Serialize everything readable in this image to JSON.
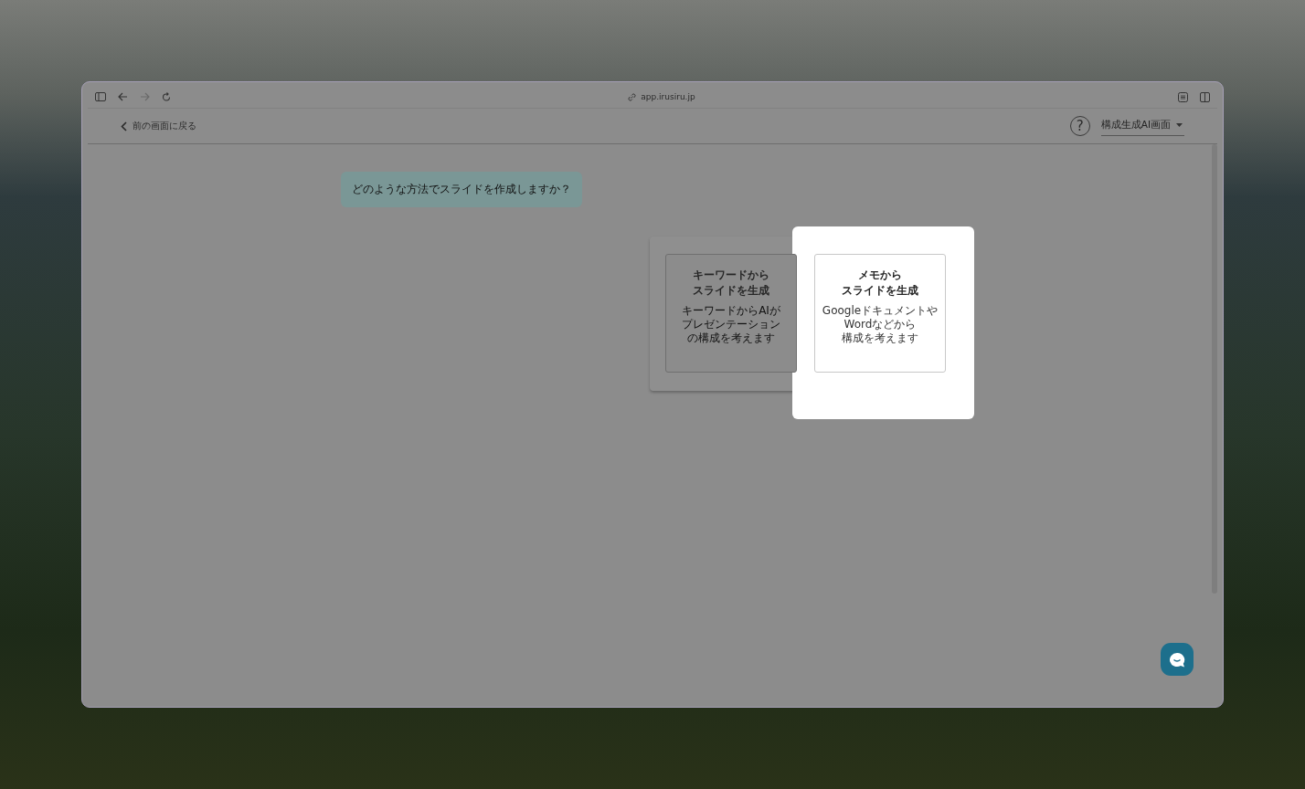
{
  "browser": {
    "url": "app.irusiru.jp"
  },
  "header": {
    "back_link": "前の画面に戻る",
    "help_button": "?",
    "mode_select": {
      "value": "構成生成AI画面"
    }
  },
  "prompt": "どのような方法でスライドを作成しますか？",
  "options": [
    {
      "title_lines": [
        "キーワードから",
        "スライドを生成"
      ],
      "description_lines": [
        "キーワードからAIが",
        "プレゼンテーション",
        "の構成を考えます"
      ],
      "highlighted": false
    },
    {
      "title_lines": [
        "メモから",
        "スライドを生成"
      ],
      "description_lines": [
        "Googleドキュメントや",
        "Wordなどから",
        "構成を考えます"
      ],
      "highlighted": true
    }
  ]
}
